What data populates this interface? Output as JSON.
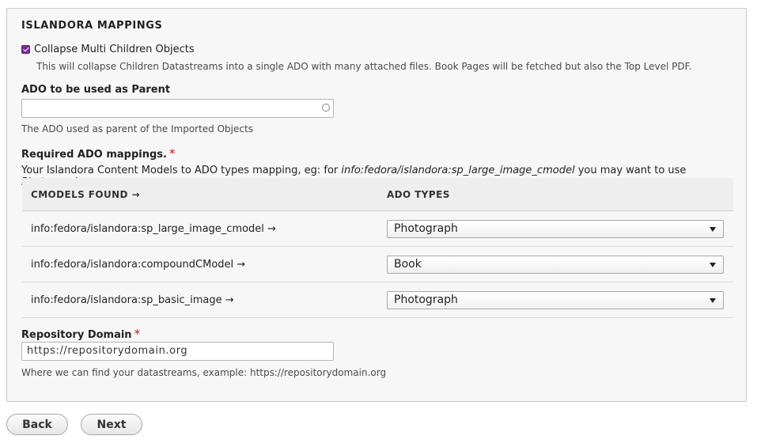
{
  "section": {
    "legend": "ISLANDORA MAPPINGS"
  },
  "collapse": {
    "label": "Collapse Multi Children Objects",
    "checked": true,
    "description": "This will collapse Children Datastreams into a single ADO with many attached files. Book Pages will be fetched but also the Top Level PDF."
  },
  "parent_ado": {
    "label": "ADO to be used as Parent",
    "value": "",
    "description": "The ADO used as parent of the Imported Objects"
  },
  "mappings": {
    "label": "Required ADO mappings.",
    "required_marker": "*",
    "help_prefix": "Your Islandora Content Models to ADO types mapping, eg: for ",
    "help_example_cmodel": "info:fedora/islandora:sp_large_image_cmodel",
    "help_middle": " you may want to use ",
    "help_example_type": "Photograph",
    "help_suffix": ".",
    "columns": [
      "CMODELS FOUND →",
      "ADO TYPES"
    ],
    "rows": [
      {
        "cmodel": "info:fedora/islandora:sp_large_image_cmodel →",
        "ado_type": "Photograph"
      },
      {
        "cmodel": "info:fedora/islandora:compoundCModel →",
        "ado_type": "Book"
      },
      {
        "cmodel": "info:fedora/islandora:sp_basic_image →",
        "ado_type": "Photograph"
      }
    ]
  },
  "repository_domain": {
    "label": "Repository Domain",
    "required_marker": "*",
    "value": "https://repositorydomain.org",
    "description": "Where we can find your datastreams, example: https://repositorydomain.org"
  },
  "buttons": {
    "back": "Back",
    "next": "Next"
  },
  "colors": {
    "checkbox_accent": "#7b2a98",
    "required_marker": "#c71616"
  }
}
